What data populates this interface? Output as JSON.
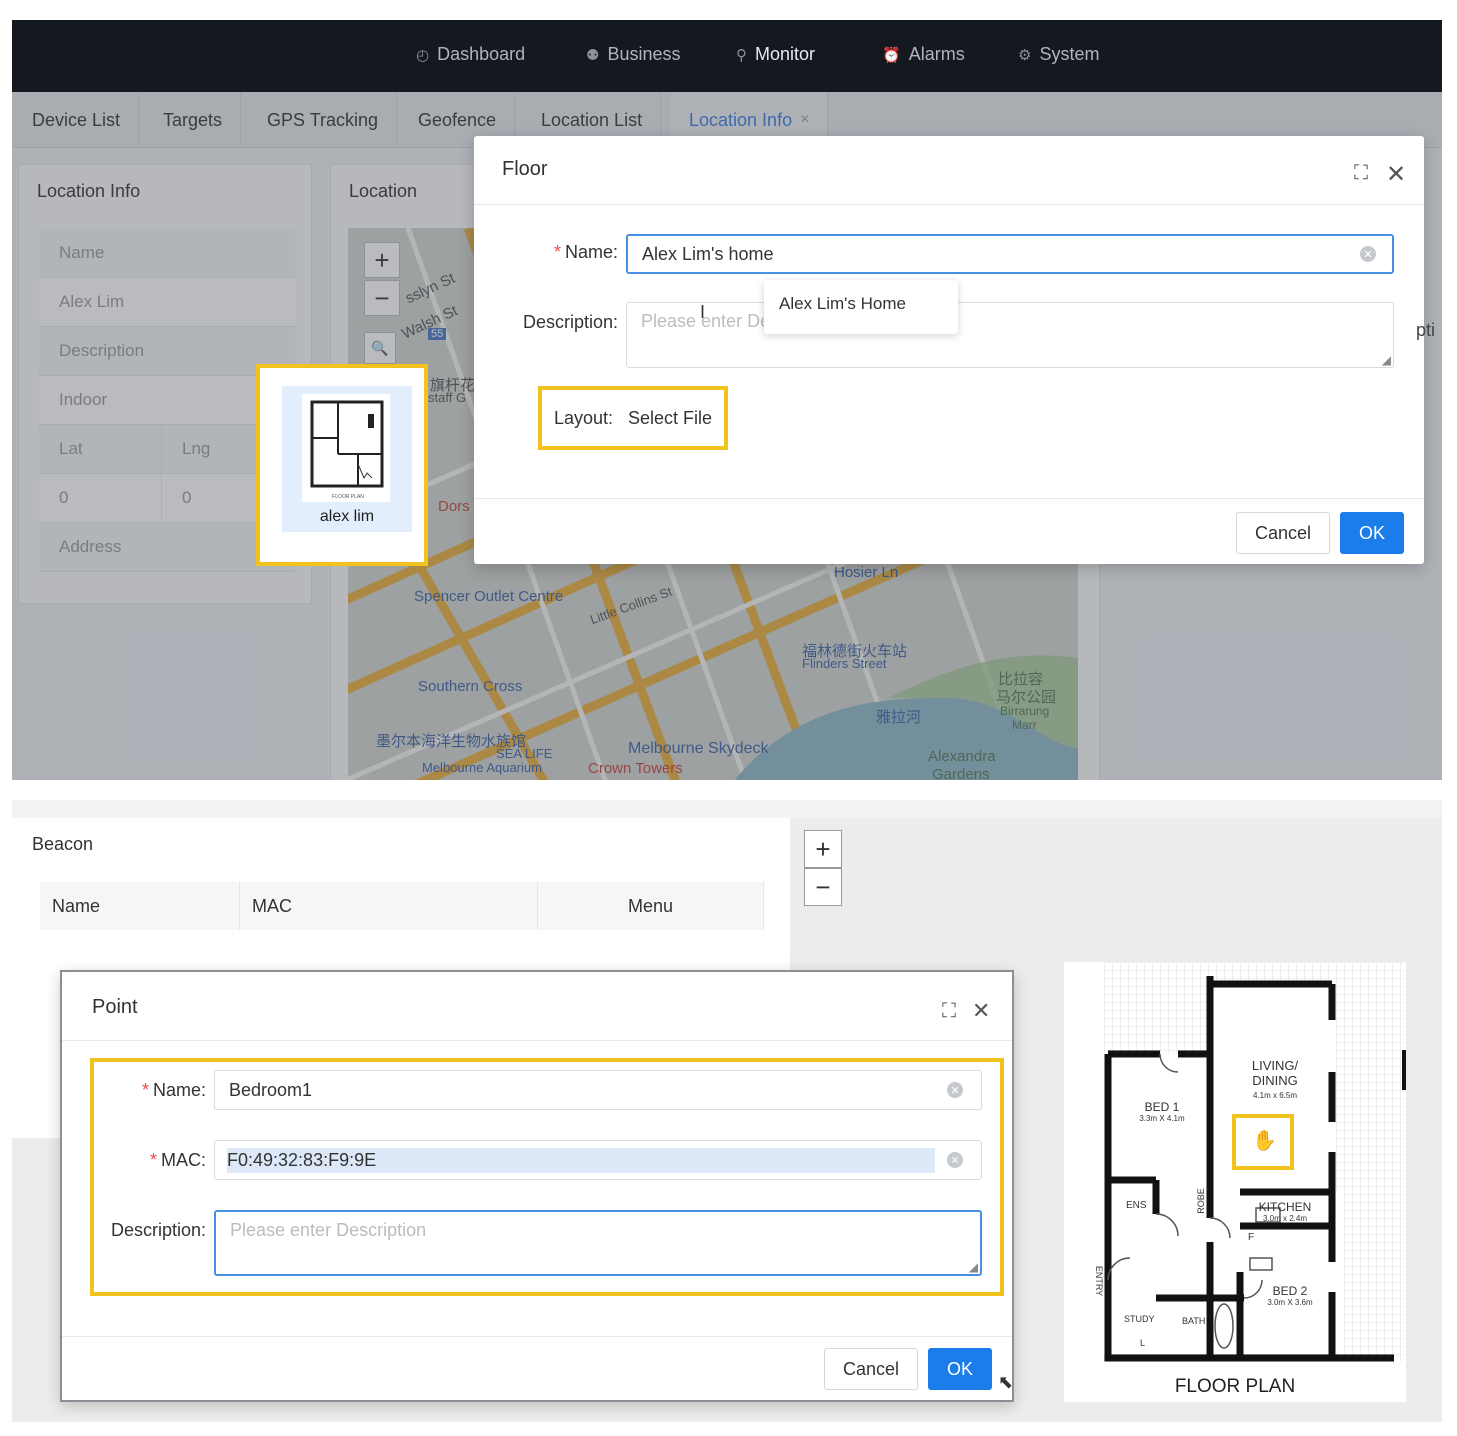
{
  "nav": {
    "items": [
      {
        "label": "Dashboard",
        "icon": "gauge-icon"
      },
      {
        "label": "Business",
        "icon": "users-icon"
      },
      {
        "label": "Monitor",
        "icon": "location-pin-icon"
      },
      {
        "label": "Alarms",
        "icon": "alarm-icon"
      },
      {
        "label": "System",
        "icon": "gear-icon"
      }
    ],
    "active": "Monitor"
  },
  "tabs": {
    "items": [
      "Device List",
      "Targets",
      "GPS Tracking",
      "Geofence",
      "Location List",
      "Location Info"
    ],
    "active": "Location Info",
    "close_symbol": "×"
  },
  "location_info": {
    "title": "Location Info",
    "name_label": "Name",
    "name_value": "Alex Lim",
    "description_label": "Description",
    "indoor_label": "Indoor",
    "lat_label": "Lat",
    "lng_label": "Lng",
    "lat_value": "0",
    "lng_value": "0",
    "address_label": "Address"
  },
  "location_map": {
    "title": "Location",
    "zoom_in": "+",
    "zoom_out": "−",
    "street_labels": [
      "sslyn St",
      "Walsh St",
      "旗杆花",
      "staff G",
      "Dors",
      "Spencer Outlet Centre",
      "Little Collins St",
      "Hosier Ln",
      "福林德街火车站",
      "Flinders Street",
      "Southern Cross",
      "比拉容",
      "马尔公园",
      "Birrarung",
      "Marr",
      "雅拉河",
      "墨尔本海洋生物水族馆",
      "SEA LIFE",
      "Melbourne Aquarium",
      "Melbourne Skydeck",
      "Crown Towers",
      "Alexandra",
      "Gardens",
      "55"
    ]
  },
  "thumbnail": {
    "caption": "alex lim",
    "plan_label": "FLOOR PLAN"
  },
  "floor_modal": {
    "title": "Floor",
    "name_label": "Name:",
    "name_value": "Alex Lim's home",
    "description_label": "Description:",
    "description_placeholder": "Please enter De",
    "autocomplete": "Alex Lim's Home",
    "layout_label": "Layout:",
    "layout_action": "Select File",
    "cancel": "Cancel",
    "ok": "OK",
    "side_fragment": "pti"
  },
  "beacon": {
    "title": "Beacon",
    "columns": [
      "Name",
      "MAC",
      "Menu"
    ]
  },
  "point_modal": {
    "title": "Point",
    "name_label": "Name:",
    "name_value": "Bedroom1",
    "mac_label": "MAC:",
    "mac_value": "F0:49:32:83:F9:9E",
    "description_label": "Description:",
    "description_placeholder": "Please enter Description",
    "cancel": "Cancel",
    "ok": "OK"
  },
  "floorplan": {
    "zoom_in": "+",
    "zoom_out": "−",
    "rooms": [
      {
        "name": "LIVING/",
        "name2": "DINING",
        "size": "4.1m x 6.5m"
      },
      {
        "name": "BED 1",
        "size": "3.3m X 4.1m"
      },
      {
        "name": "KITCHEN",
        "size": "3.0m x 2.4m"
      },
      {
        "name": "BED 2",
        "size": "3.0m X 3.6m"
      },
      {
        "name": "ENS"
      },
      {
        "name": "ROBE"
      },
      {
        "name": "STUDY"
      },
      {
        "name": "BATH"
      },
      {
        "name": "ENTRY"
      },
      {
        "name": "F"
      },
      {
        "name": "L"
      }
    ],
    "title": "FLOOR PLAN"
  },
  "colors": {
    "accent": "#1a7dea",
    "highlight": "#f2c21e",
    "nav_bg": "#14181f",
    "required": "#f04848"
  }
}
